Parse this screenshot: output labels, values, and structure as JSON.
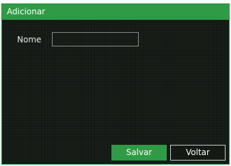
{
  "dialog": {
    "title": "Adicionar"
  },
  "form": {
    "name_label": "Nome",
    "name_value": ""
  },
  "buttons": {
    "save_label": "Salvar",
    "back_label": "Voltar"
  },
  "colors": {
    "accent": "#2f9b46",
    "background": "#141914",
    "text": "#ffffff"
  }
}
